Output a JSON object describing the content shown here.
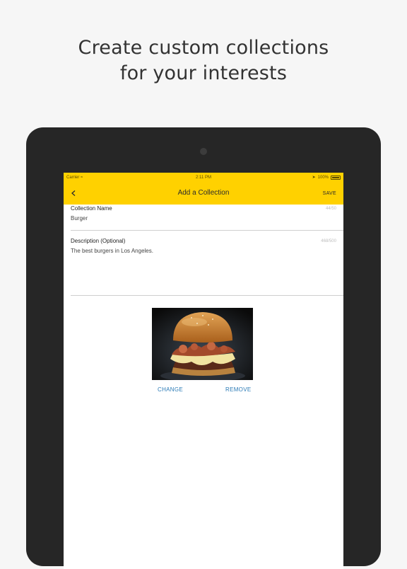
{
  "headline": {
    "line1": "Create custom collections",
    "line2": "for your interests"
  },
  "status_bar": {
    "carrier": "Carrier",
    "time": "2:11 PM",
    "battery_text": "100%",
    "battery_level": 1.0
  },
  "nav": {
    "title": "Add a Collection",
    "save_label": "SAVE",
    "back_icon": "chevron-left-icon"
  },
  "form": {
    "name": {
      "label": "Collection Name",
      "value": "Burger",
      "counter": "44/50"
    },
    "description": {
      "label": "Description (Optional)",
      "value": "The best burgers in Los Angeles.",
      "counter": "468/500"
    }
  },
  "photo": {
    "change_label": "CHANGE",
    "remove_label": "REMOVE"
  },
  "colors": {
    "accent": "#ffd100",
    "action_blue": "#2c7bb6",
    "device": "#262626"
  }
}
